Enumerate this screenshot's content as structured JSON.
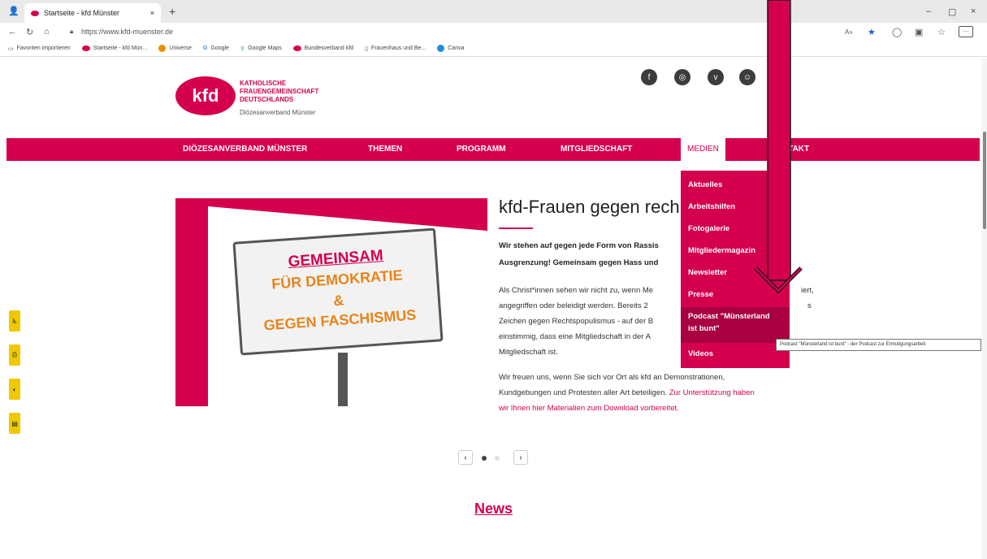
{
  "browser": {
    "tab_title": "Startseite - kfd Münster",
    "tab_close": "×",
    "new_tab": "+",
    "window_controls": [
      "–",
      "▢",
      "×"
    ],
    "url": "https://www.kfd-muenster.de",
    "bookmarks": [
      "Favoriten importieren",
      "Startseite - kfd Mün...",
      "Universe",
      "Google",
      "Google Maps",
      "Bundesverband kfd",
      "Frauenhaus und Be...",
      "Canva"
    ]
  },
  "header": {
    "logo_text": "kfd",
    "org_line1": "KATHOLISCHE",
    "org_line2": "FRAUENGEMEINSCHAFT",
    "org_line3": "DEUTSCHLANDS",
    "org_sub": "Diözesanverband Münster",
    "social": [
      "f",
      "◎",
      "v",
      "☺"
    ]
  },
  "nav": {
    "items": [
      "DIÖZESANVERBAND MÜNSTER",
      "THEMEN",
      "PROGRAMM",
      "MITGLIEDSCHAFT",
      "MEDIEN",
      "KONTAKT"
    ],
    "kontakt_visible": "NTAKT"
  },
  "dropdown": {
    "items": [
      "Aktuelles",
      "Arbeitshilfen",
      "Fotogalerie",
      "Mitgliedermagazin",
      "Newsletter",
      "Presse",
      "Podcast \"Münsterland",
      "ist bunt\"",
      "Videos"
    ]
  },
  "tooltip": "Podcast \"Münsterland ist bunt\" - der Podcast zur Ermutigungsarbeit",
  "slide": {
    "sign_line1": "GEMEINSAM",
    "sign_line2": "FÜR DEMOKRATIE",
    "sign_line3": "&",
    "sign_line4": "GEGEN FASCHISMUS",
    "headline": "kfd-Frauen gegen rech",
    "bold1": "Wir stehen auf gegen jede Form von Rassis",
    "bold2": "Ausgrenzung! Gemeinsam gegen Hass und",
    "p1": "Als Christ*innen sehen wir nicht zu, wenn Me",
    "p1_end": "iert,",
    "p2": "angegriffen oder beleidigt werden. Bereits 2",
    "p2_end": "s",
    "p3": "Zeichen gegen Rechtspopulismus - auf der B",
    "p4": "einstimmig, dass eine Mitgliedschaft in der A",
    "p5": "Mitgliedschaft ist.",
    "p6": "Wir freuen uns, wenn Sie sich vor Ort als kfd an Demonstrationen,",
    "p7a": "Kundgebungen und Protesten aller Art beteiligen. ",
    "p7_link": "Zur Unterstützung haben",
    "p8_link": "wir Ihnen hier Materialien zum Download vorbereitet."
  },
  "pager": {
    "prev": "‹",
    "next": "›"
  },
  "news_title": "News",
  "colors": {
    "brand": "#d4004e",
    "arrow": "#d4004e"
  }
}
